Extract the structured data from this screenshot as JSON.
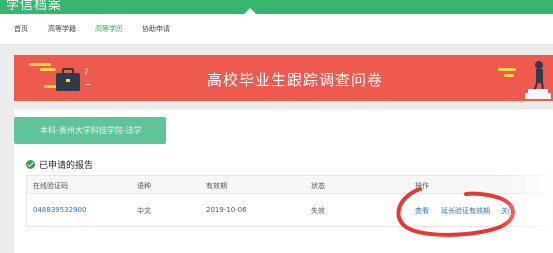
{
  "header": {
    "logo_text": "学信档案"
  },
  "nav": {
    "items": [
      {
        "label": "首页",
        "active": false
      },
      {
        "label": "高等学籍",
        "active": false
      },
      {
        "label": "高等学历",
        "active": true
      },
      {
        "label": "协助申请",
        "active": false
      }
    ]
  },
  "banner": {
    "title": "高校毕业生跟踪调查问卷"
  },
  "school_button": {
    "label": "本科-贵州大学科技学院-法学"
  },
  "reports": {
    "section_title": "已申请的报告",
    "columns": [
      "在线验证码",
      "语种",
      "有效期",
      "状态",
      "操作"
    ],
    "rows": [
      {
        "code": "048839532900",
        "language": "中文",
        "expiry": "2019-10-06",
        "status": "失效",
        "action_view": "查看",
        "action_extend": "延长验证有效期",
        "action_close": "关闭"
      }
    ]
  },
  "colors": {
    "brand_green": "#38b66d",
    "banner_red": "#ef5a4f",
    "link_blue": "#2f74b8",
    "annotation_red": "#e53935"
  }
}
